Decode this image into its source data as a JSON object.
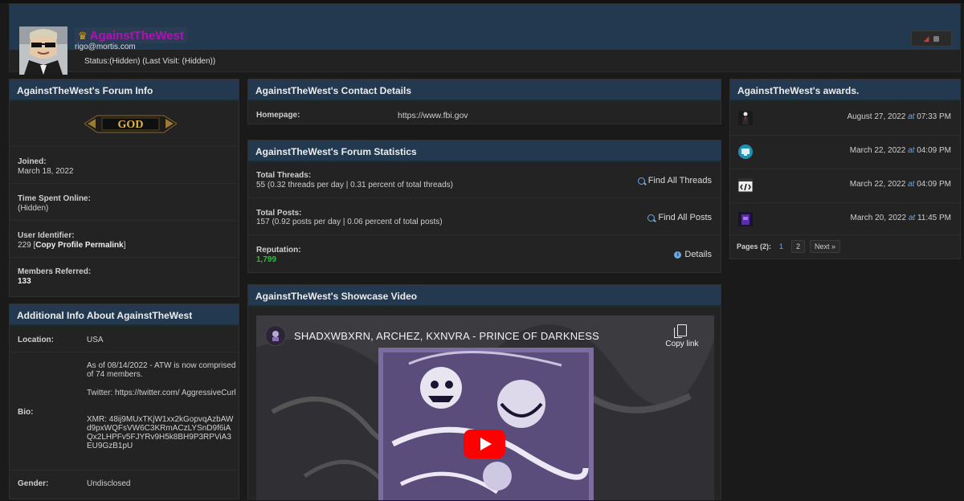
{
  "profile": {
    "username": "AgainstTheWest",
    "email": "rigo@mortis.com",
    "status": "Status:(Hidden) (Last Visit: (Hidden))"
  },
  "forum_info": {
    "title": "AgainstTheWest's Forum Info",
    "badge": "GOD",
    "joined_label": "Joined:",
    "joined_value": "March 18, 2022",
    "online_label": "Time Spent Online:",
    "online_value": "(Hidden)",
    "uid_label": "User Identifier:",
    "uid_number": "229 [",
    "uid_link": "Copy Profile Permalink",
    "uid_close": "]",
    "referred_label": "Members Referred:",
    "referred_value": "133"
  },
  "additional": {
    "title": "Additional Info About AgainstTheWest",
    "location_label": "Location:",
    "location_value": "USA",
    "bio_label": "Bio:",
    "bio_line1": "As of 08/14/2022 - ATW is now comprised of 74 members.",
    "bio_line2": "Twitter: https://twitter.com/ AggressiveCurl",
    "bio_line3": "XMR: 48ij9MUxTKjW1xx2kGopvqAzbAWd9pxWQFsVW6C3KRmACzLYSnD9f6iAQx2LHPFv5FJYRv9H5k8BH9P3RPViA3EU9GzB1pU",
    "gender_label": "Gender:",
    "gender_value": "Undisclosed"
  },
  "contact": {
    "title": "AgainstTheWest's Contact Details",
    "homepage_label": "Homepage:",
    "homepage_value": "https://www.fbi.gov"
  },
  "stats": {
    "title": "AgainstTheWest's Forum Statistics",
    "threads_label": "Total Threads:",
    "threads_value": "55 (0.32 threads per day | 0.31 percent of total threads)",
    "find_threads": "Find All Threads",
    "posts_label": "Total Posts:",
    "posts_value": "157 (0.92 posts per day | 0.06 percent of total posts)",
    "find_posts": "Find All Posts",
    "rep_label": "Reputation:",
    "rep_value": "1,799",
    "details": "Details"
  },
  "video": {
    "title": "AgainstTheWest's Showcase Video",
    "video_title": "SHADXWBXRN, ARCHEZ, KXNVRA - PRINCE OF DARKNESS",
    "copy_link": "Copy link"
  },
  "awards": {
    "title": "AgainstTheWest's awards.",
    "items": [
      {
        "icon": "suit-figure-icon",
        "date": "August 27, 2022",
        "at": "at",
        "time": "07:33 PM"
      },
      {
        "icon": "monitor-icon",
        "date": "March 22, 2022",
        "at": "at",
        "time": "04:09 PM"
      },
      {
        "icon": "code-tag-icon",
        "date": "March 22, 2022",
        "at": "at",
        "time": "04:09 PM"
      },
      {
        "icon": "purple-figure-icon",
        "date": "March 20, 2022",
        "at": "at",
        "time": "11:45 PM"
      }
    ],
    "pages_label": "Pages (2):",
    "page_current": "1",
    "page_2": "2",
    "next": "Next »"
  },
  "colors": {
    "header_blue": "#23394f",
    "username_purple": "#b010b8",
    "reputation_green": "#2ebc3c",
    "link_blue": "#6ea8e0"
  }
}
